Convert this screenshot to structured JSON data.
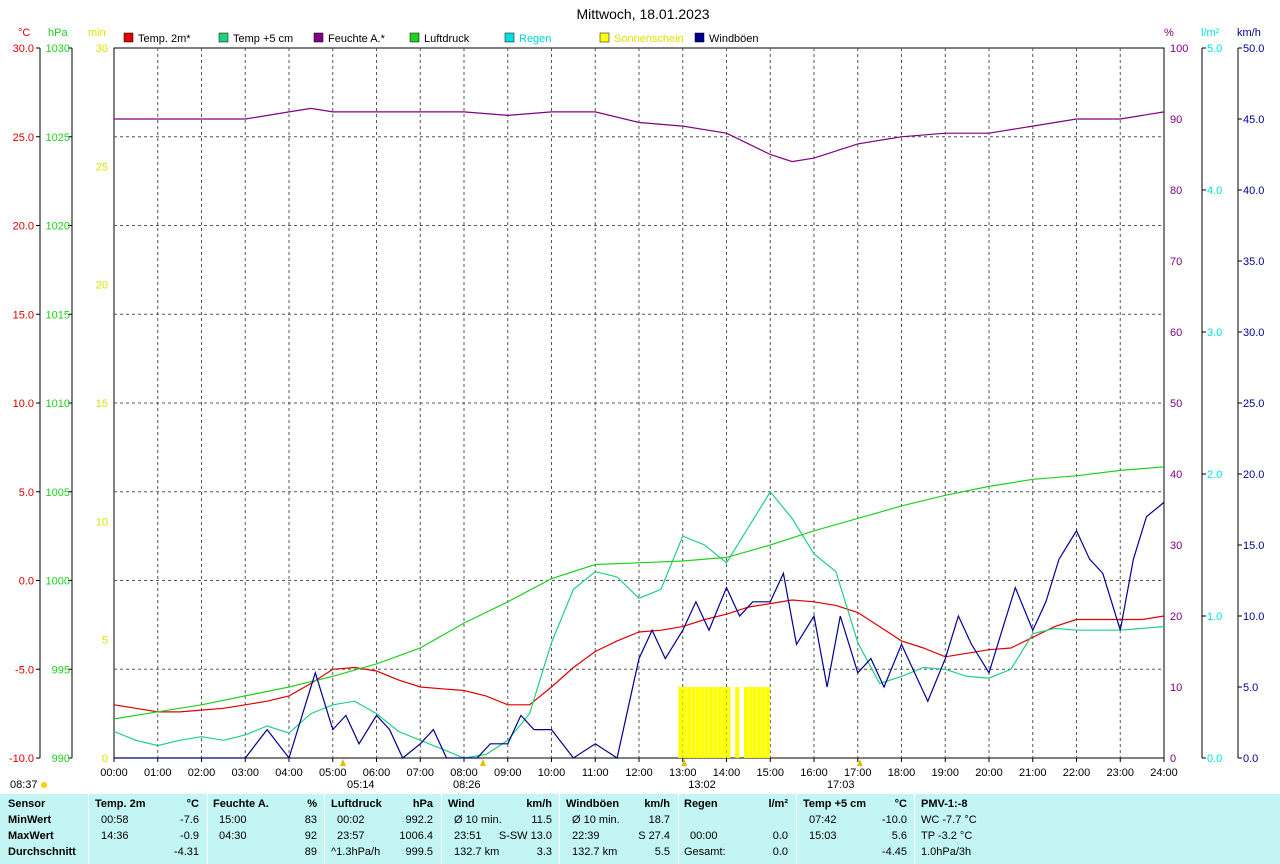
{
  "title": "Mittwoch, 18.01.2023",
  "colors": {
    "temp2m": "#e00000",
    "temp5cm": "#20d080",
    "feuchte": "#800080",
    "luftdruck": "#20d020",
    "regen": "#00e0e0",
    "sonne": "#ffff00",
    "wind": "#000090"
  },
  "legend": [
    {
      "label": "Temp. 2m*",
      "color": "#e00000"
    },
    {
      "label": "Temp +5 cm",
      "color": "#20d080"
    },
    {
      "label": "Feuchte A.*",
      "color": "#800080"
    },
    {
      "label": "Luftdruck",
      "color": "#20d020"
    },
    {
      "label": "Regen",
      "color": "#00e0e0"
    },
    {
      "label": "Sonnenschein",
      "color": "#ffff00"
    },
    {
      "label": "Windböen",
      "color": "#000090"
    }
  ],
  "axis_units": {
    "temp": "°C",
    "pressure": "hPa",
    "sun": "min",
    "humidity": "%",
    "rain": "l/m²",
    "wind": "km/h"
  },
  "axis_ticks": {
    "temp": [
      "30.0",
      "25.0",
      "20.0",
      "15.0",
      "10.0",
      "5.0",
      "0.0",
      "-5.0",
      "-10.0"
    ],
    "pressure": [
      "1030",
      "1025",
      "1020",
      "1015",
      "1010",
      "1005",
      "1000",
      "995",
      "990"
    ],
    "sun": [
      "30",
      "25",
      "20",
      "15",
      "10",
      "5",
      "0"
    ],
    "humidity": [
      "100",
      "90",
      "80",
      "70",
      "60",
      "50",
      "40",
      "30",
      "20",
      "10",
      "0"
    ],
    "rain": [
      "5.0",
      "4.0",
      "3.0",
      "2.0",
      "1.0",
      "0.0"
    ],
    "wind": [
      "50.0",
      "45.0",
      "40.0",
      "35.0",
      "30.0",
      "25.0",
      "20.0",
      "15.0",
      "10.0",
      "5.0",
      "0.0"
    ],
    "time": [
      "00:00",
      "01:00",
      "02:00",
      "03:00",
      "04:00",
      "05:00",
      "06:00",
      "07:00",
      "08:00",
      "09:00",
      "10:00",
      "11:00",
      "12:00",
      "13:00",
      "14:00",
      "15:00",
      "16:00",
      "17:00",
      "18:00",
      "19:00",
      "20:00",
      "21:00",
      "22:00",
      "23:00",
      "24:00"
    ]
  },
  "markers": {
    "sunrise": "08:37",
    "twilight_start": "05:14",
    "dawn": "08:26",
    "noon": "13:02",
    "sunset": "17:03"
  },
  "chart_data": {
    "type": "line",
    "title": "Mittwoch, 18.01.2023",
    "x_range": [
      "00:00",
      "24:00"
    ],
    "series": [
      {
        "name": "Temp. 2m*",
        "axis": "temp",
        "ylim": [
          -10,
          30
        ],
        "x": [
          0,
          0.5,
          1,
          1.5,
          2,
          2.5,
          3,
          3.5,
          4,
          4.5,
          5,
          5.5,
          6,
          6.5,
          7,
          7.5,
          8,
          8.5,
          9,
          9.5,
          10,
          10.5,
          11,
          11.5,
          12,
          12.5,
          13,
          13.5,
          14,
          14.5,
          15,
          15.5,
          16,
          16.5,
          17,
          17.5,
          18,
          18.5,
          19,
          19.5,
          20,
          20.5,
          21,
          21.5,
          22,
          22.5,
          23,
          23.5,
          24
        ],
        "y": [
          -7.0,
          -7.2,
          -7.4,
          -7.4,
          -7.3,
          -7.2,
          -7.0,
          -6.8,
          -6.5,
          -5.8,
          -5.0,
          -4.9,
          -5.1,
          -5.6,
          -6.0,
          -6.1,
          -6.2,
          -6.5,
          -7.0,
          -7.0,
          -6.0,
          -4.9,
          -4.0,
          -3.4,
          -2.9,
          -2.8,
          -2.6,
          -2.2,
          -1.9,
          -1.5,
          -1.3,
          -1.1,
          -1.2,
          -1.4,
          -1.8,
          -2.6,
          -3.4,
          -3.8,
          -4.3,
          -4.1,
          -3.9,
          -3.8,
          -3.2,
          -2.6,
          -2.2,
          -2.2,
          -2.2,
          -2.2,
          -2.0
        ]
      },
      {
        "name": "Temp +5 cm",
        "axis": "temp",
        "ylim": [
          -10,
          30
        ],
        "x": [
          0,
          0.5,
          1,
          1.5,
          2,
          2.5,
          3,
          3.5,
          4,
          4.5,
          5,
          5.5,
          6,
          6.5,
          7,
          7.5,
          8,
          8.5,
          9,
          9.5,
          10,
          10.5,
          11,
          11.5,
          12,
          12.5,
          13,
          13.5,
          14,
          14.5,
          15,
          15.5,
          16,
          16.5,
          17,
          17.5,
          18,
          18.5,
          19,
          19.5,
          20,
          20.5,
          21,
          21.5,
          22,
          22.5,
          23,
          23.5,
          24
        ],
        "y": [
          -8.5,
          -9.0,
          -9.3,
          -9.0,
          -8.8,
          -9.0,
          -8.7,
          -8.2,
          -8.6,
          -7.5,
          -7.0,
          -6.8,
          -7.5,
          -8.5,
          -9.0,
          -9.5,
          -10.0,
          -9.8,
          -9.0,
          -7.5,
          -3.5,
          -0.5,
          0.5,
          0.2,
          -1.0,
          -0.5,
          2.5,
          2.0,
          1.0,
          3.0,
          5.0,
          3.5,
          1.5,
          0.5,
          -3.5,
          -5.8,
          -5.4,
          -4.9,
          -5.0,
          -5.4,
          -5.5,
          -5.0,
          -3.0,
          -2.7,
          -2.8,
          -2.8,
          -2.8,
          -2.7,
          -2.6
        ]
      },
      {
        "name": "Feuchte A.*",
        "axis": "humidity",
        "ylim": [
          0,
          100
        ],
        "x": [
          0,
          1,
          2,
          3,
          4,
          4.5,
          5,
          6,
          7,
          8,
          9,
          10,
          11,
          12,
          13,
          14,
          15,
          15.5,
          16,
          17,
          18,
          19,
          20,
          21,
          22,
          23,
          24
        ],
        "y": [
          90,
          90,
          90,
          90,
          91,
          91.5,
          91,
          91,
          91,
          91,
          90.5,
          91,
          91,
          89.5,
          89,
          88,
          85,
          84,
          84.5,
          86.5,
          87.5,
          88,
          88,
          89,
          90,
          90,
          91
        ]
      },
      {
        "name": "Luftdruck",
        "axis": "pressure",
        "ylim": [
          990,
          1030
        ],
        "x": [
          0,
          1,
          2,
          3,
          4,
          5,
          6,
          7,
          8,
          9,
          10,
          11,
          12,
          13,
          14,
          15,
          16,
          17,
          18,
          19,
          20,
          21,
          22,
          23,
          24
        ],
        "y": [
          992.2,
          992.6,
          993.0,
          993.5,
          994.0,
          994.6,
          995.3,
          996.2,
          997.6,
          998.8,
          1000.1,
          1000.9,
          1001.0,
          1001.1,
          1001.3,
          1002.0,
          1002.8,
          1003.5,
          1004.2,
          1004.8,
          1005.3,
          1005.7,
          1005.9,
          1006.2,
          1006.4
        ]
      },
      {
        "name": "Windböen",
        "axis": "wind",
        "ylim": [
          0,
          50
        ],
        "x": [
          0,
          3,
          3.5,
          4,
          4.3,
          4.6,
          5,
          5.3,
          5.6,
          6,
          6.3,
          6.6,
          7,
          7.3,
          7.6,
          8,
          8.3,
          8.6,
          9,
          9.3,
          9.6,
          10,
          10.5,
          11,
          11.5,
          12,
          12.3,
          12.6,
          13,
          13.3,
          13.6,
          14,
          14.3,
          14.6,
          15,
          15.3,
          15.6,
          16,
          16.3,
          16.6,
          17,
          17.3,
          17.6,
          18,
          18.3,
          18.6,
          19,
          19.3,
          19.6,
          20,
          20.3,
          20.6,
          21,
          21.3,
          21.6,
          22,
          22.3,
          22.6,
          23,
          23.3,
          23.6,
          24
        ],
        "y": [
          0,
          0,
          2,
          0,
          3,
          6,
          2,
          3,
          1,
          3,
          2,
          0,
          1,
          2,
          0,
          0,
          0,
          1,
          1,
          3,
          2,
          2,
          0,
          1,
          0,
          7,
          9,
          7,
          9,
          11,
          9,
          12,
          10,
          11,
          11,
          13,
          8,
          10,
          5,
          10,
          6,
          7,
          5,
          8,
          6,
          4,
          7,
          10,
          8,
          6,
          9,
          12,
          9,
          11,
          14,
          16,
          14,
          13,
          9,
          14,
          17,
          18
        ]
      },
      {
        "name": "Sonnenschein",
        "axis": "sun",
        "ylim": [
          0,
          30
        ],
        "type": "bar",
        "x": [
          12.9,
          13.0,
          13.1,
          13.2,
          13.3,
          13.4,
          13.5,
          13.6,
          13.7,
          13.8,
          13.9,
          14.0,
          14.2,
          14.4,
          14.5,
          14.6,
          14.7,
          14.8,
          14.9
        ],
        "y": [
          3,
          3,
          3,
          3,
          3,
          3,
          3,
          3,
          3,
          3,
          3,
          3,
          3,
          3,
          3,
          3,
          3,
          3,
          3
        ]
      }
    ]
  },
  "stats": {
    "sensor": {
      "h": "Sensor",
      "r1": "MinWert",
      "r2": "MaxWert",
      "r3": "Durchschnitt"
    },
    "temp2m": {
      "h": "Temp. 2m",
      "u": "°C",
      "t1": "00:58",
      "v1": "-7.6",
      "t2": "14:36",
      "v2": "-0.9",
      "t3": "",
      "v3": "-4.31"
    },
    "feuchte": {
      "h": "Feuchte A.",
      "u": "%",
      "t1": "15:00",
      "v1": "83",
      "t2": "04:30",
      "v2": "92",
      "t3": "",
      "v3": "89"
    },
    "luftdruck": {
      "h": "Luftdruck",
      "u": "hPa",
      "t1": "00:02",
      "v1": "992.2",
      "t2": "23:57",
      "v2": "1006.4",
      "t3": "^1.3hPa/h",
      "v3": "999.5"
    },
    "wind": {
      "h": "Wind",
      "u": "km/h",
      "t1": "Ø 10 min.",
      "v1": "11.5",
      "t2": "23:51",
      "m2": "S-SW 13.0",
      "v2": "",
      "t3": "132.7 km",
      "v3": "3.3"
    },
    "windboeen": {
      "h": "Windböen",
      "u": "km/h",
      "t1": "Ø 10 min.",
      "v1": "18.7",
      "t2": "22:39",
      "m2": "S 27.4",
      "v2": "",
      "t3": "132.7 km",
      "v3": "5.5"
    },
    "regen": {
      "h": "Regen",
      "u": "l/m²",
      "t1": "",
      "v1": "",
      "t2": "00:00",
      "v2": "0.0",
      "t3": "Gesamt:",
      "v3": "0.0",
      "v0": "0.0"
    },
    "temp5cm": {
      "h": "Temp +5 cm",
      "u": "°C",
      "t1": "07:42",
      "v1": "-10.0",
      "t2": "15:03",
      "v2": "5.6",
      "t3": "",
      "v3": "-4.45"
    },
    "pmv": {
      "h": "PMV-1:-8",
      "l1": "WC -7.7 °C",
      "l2": "TP -3.2 °C",
      "l3": "1.0hPa/3h"
    }
  }
}
